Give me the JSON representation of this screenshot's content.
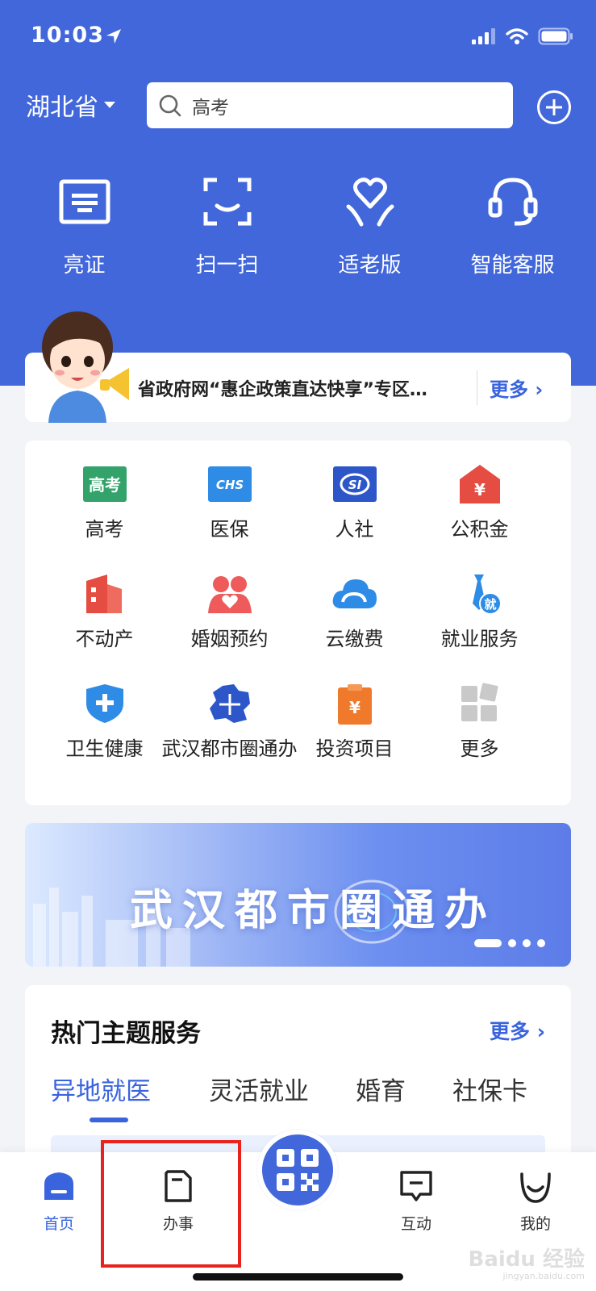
{
  "status_bar": {
    "time": "10:03"
  },
  "header": {
    "province": "湖北省",
    "search_placeholder": "高考"
  },
  "quick_actions": [
    {
      "label": "亮证",
      "icon": "id-card-icon"
    },
    {
      "label": "扫一扫",
      "icon": "scan-icon"
    },
    {
      "label": "适老版",
      "icon": "elderly-heart-icon"
    },
    {
      "label": "智能客服",
      "icon": "headset-icon"
    }
  ],
  "notice": {
    "text": "省政府网“惠企政策直达快享”专区…",
    "more": "更多"
  },
  "services": [
    {
      "label": "高考",
      "icon": "gaokao-icon",
      "icon_text": "高考",
      "color": "#33a36b"
    },
    {
      "label": "医保",
      "icon": "medical-insurance-icon",
      "icon_text": "CHS",
      "color": "#2e8be6"
    },
    {
      "label": "人社",
      "icon": "social-security-icon",
      "icon_text": "SI",
      "color": "#2d57c9"
    },
    {
      "label": "公积金",
      "icon": "housing-fund-icon",
      "icon_text": "¥",
      "color": "#e54d42"
    },
    {
      "label": "不动产",
      "icon": "real-estate-icon",
      "icon_text": "",
      "color": "#e54d42"
    },
    {
      "label": "婚姻预约",
      "icon": "marriage-icon",
      "icon_text": "",
      "color": "#ef5a5a"
    },
    {
      "label": "云缴费",
      "icon": "cloud-payment-icon",
      "icon_text": "",
      "color": "#2e8be6"
    },
    {
      "label": "就业服务",
      "icon": "employment-icon",
      "icon_text": "就",
      "color": "#2e8be6"
    },
    {
      "label": "卫生健康",
      "icon": "health-icon",
      "icon_text": "",
      "color": "#2e8be6"
    },
    {
      "label": "武汉都市圈通办",
      "icon": "wuhan-circle-icon",
      "icon_text": "",
      "color": "#2d57c9"
    },
    {
      "label": "投资项目",
      "icon": "investment-icon",
      "icon_text": "¥",
      "color": "#f07a2c"
    },
    {
      "label": "更多",
      "icon": "more-grid-icon",
      "icon_text": "",
      "color": "#c9c9c9"
    }
  ],
  "banner": {
    "title": "武汉都市圈通办"
  },
  "topics": {
    "title": "热门主题服务",
    "more": "更多",
    "tabs": [
      "异地就医",
      "灵活就业",
      "婚育",
      "社保卡"
    ]
  },
  "tabbar": {
    "items": [
      {
        "label": "首页",
        "icon": "home-icon"
      },
      {
        "label": "办事",
        "icon": "service-doc-icon"
      },
      {
        "label": "互动",
        "icon": "chat-icon"
      },
      {
        "label": "我的",
        "icon": "profile-smile-icon"
      }
    ]
  },
  "watermark": {
    "text": "Baidu 经验",
    "sub": "jingyan.baidu.com"
  }
}
